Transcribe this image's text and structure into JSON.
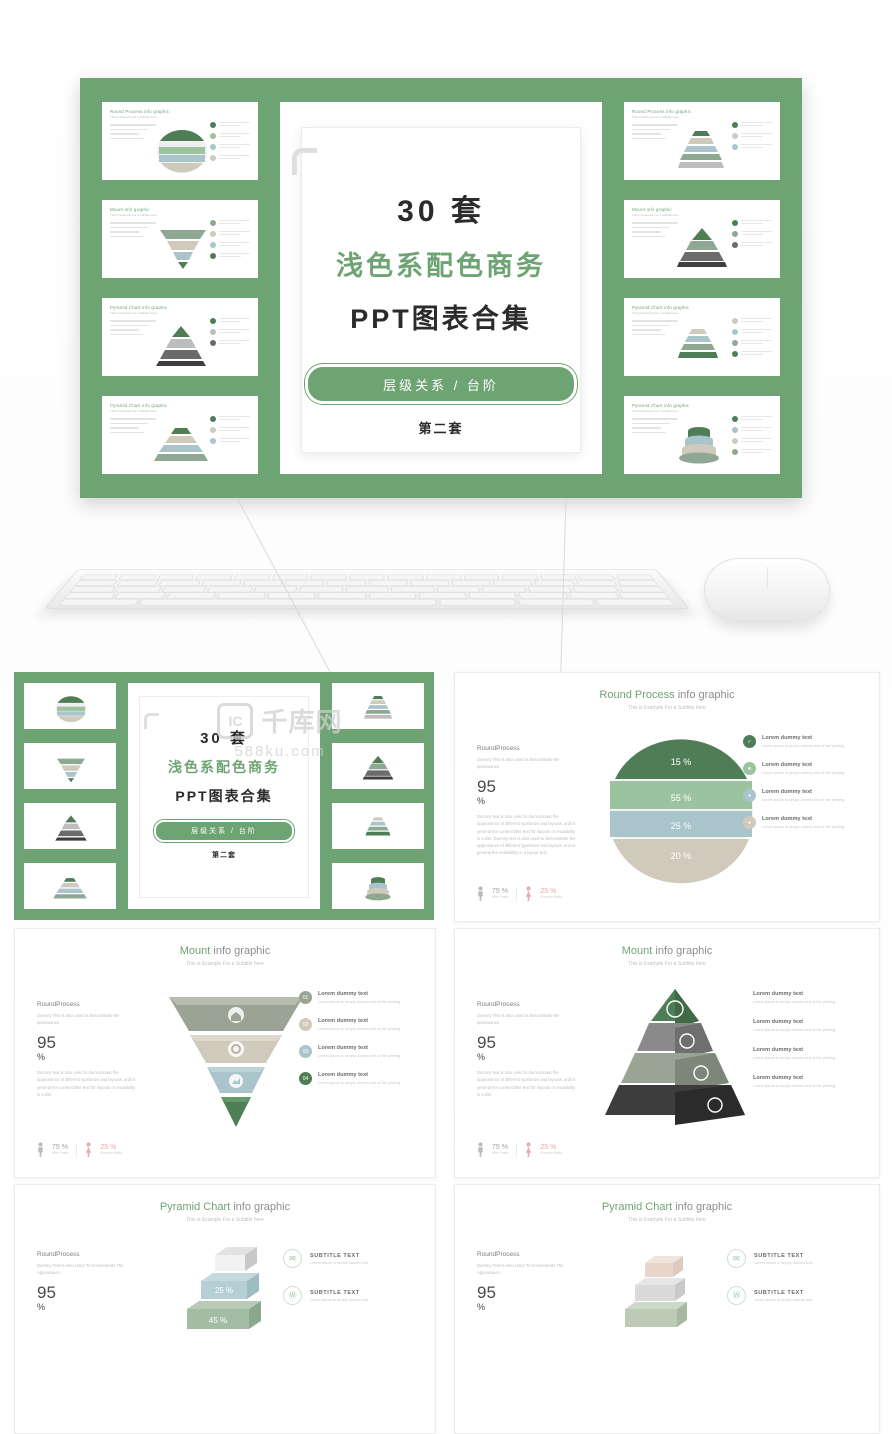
{
  "hero": {
    "line1": "30 套",
    "line2": "浅色系配色商务",
    "line3": "PPT图表合集",
    "pill": "层级关系 / 台阶",
    "subtitle": "第二套",
    "thumb_titles": [
      "Round Process info graphic",
      "Mount info graphic",
      "Pyramid Chart info graphic",
      "Pyramid Chart info graphic",
      "Round Process info graphic",
      "Mount info graphic",
      "Pyramid Chart info graphic",
      "Pyramid Chart info graphic"
    ],
    "thumb_subtitle": "This is Example For a Subtitle here"
  },
  "watermark": {
    "line1": "千库网",
    "line2": "588ku.com",
    "logo": "IC"
  },
  "slides": [
    {
      "id": "cover-thumb",
      "line1": "30 套",
      "line2": "浅色系配色商务",
      "line3": "PPT图表合集",
      "pill": "层级关系 / 台阶",
      "subtitle": "第二套"
    },
    {
      "id": "round-process",
      "title_accent": "Round Process",
      "title_rest": " info graphic",
      "subtitle": "This is Example For a Subtitle here",
      "left_label": "RoundProcess",
      "left_desc": "Dummy Text is also used to demonstrate the appearance",
      "big_number": "95",
      "unit": "%",
      "paragraph": "Dummy text is also used to demonstrate the appearance of different typefaces and layouts, and in general the content filler text for layouts or readability in a site.  Dummy text is also used to demonstrate the appearance of different typefaces and layouts, and in general the readability in a layout text.",
      "footer": [
        {
          "value": "75 %",
          "caption": "Man Ratio"
        },
        {
          "value": "25 %",
          "caption": "Women Ratio"
        }
      ],
      "chart_labels": [
        "15 %",
        "55 %",
        "25 %",
        "20 %"
      ],
      "legend": [
        {
          "title": "Lorem dummy text",
          "desc": "Lorem ipsum is simply dummy text of the printing."
        },
        {
          "title": "Lorem dummy text",
          "desc": "Lorem ipsum is simply dummy text of the printing."
        },
        {
          "title": "Lorem dummy text",
          "desc": "Lorem ipsum is simply dummy text of the printing."
        },
        {
          "title": "Lorem dummy text",
          "desc": "Lorem ipsum is simply dummy text of the printing."
        }
      ]
    },
    {
      "id": "mount-funnel",
      "title_accent": "Mount",
      "title_rest": " info graphic",
      "subtitle": "This is Example For a Subtitle here",
      "left_label": "RoundProcess",
      "left_desc": "Dummy Text is also used to demonstrate the appearance",
      "big_number": "95",
      "unit": "%",
      "paragraph": "Dummy text is also used to demonstrate the appearance of different typefaces and layouts, and in general the content filler text for layouts or readability in a site.",
      "footer": [
        {
          "value": "75 %",
          "caption": "Man Ratio"
        },
        {
          "value": "25 %",
          "caption": "Women Ratio"
        }
      ],
      "legend": [
        {
          "title": "Lorem dummy text",
          "desc": "Lorem ipsum is simply dummy text of the printing."
        },
        {
          "title": "Lorem dummy text",
          "desc": "Lorem ipsum is simply dummy text of the printing."
        },
        {
          "title": "Lorem dummy text",
          "desc": "Lorem ipsum is simply dummy text of the printing."
        },
        {
          "title": "Lorem dummy text",
          "desc": "Lorem ipsum is simply dummy text of the printing."
        }
      ],
      "icons": [
        "home-icon",
        "gear-icon",
        "chart-icon"
      ]
    },
    {
      "id": "mount-pyramid",
      "title_accent": "Mount",
      "title_rest": " info graphic",
      "subtitle": "This is Example For a Subtitle here",
      "left_label": "RoundProcess",
      "left_desc": "Dummy Text is also used to demonstrate the appearance",
      "big_number": "95",
      "unit": "%",
      "paragraph": "Dummy text is also used to demonstrate the appearance of different typefaces and layouts, and in general the content filler text for layouts or readability in a site.",
      "footer": [
        {
          "value": "75 %",
          "caption": "Man Ratio"
        },
        {
          "value": "25 %",
          "caption": "Women Ratio"
        }
      ],
      "callouts": [
        {
          "title": "Lorem dummy text",
          "desc": "Lorem ipsum is simply dummy text of the printing.",
          "icon": "bulb-icon"
        },
        {
          "title": "Lorem dummy text",
          "desc": "Lorem ipsum is simply dummy text of the printing.",
          "icon": "search-icon"
        },
        {
          "title": "Lorem dummy text",
          "desc": "Lorem ipsum is simply dummy text of the printing.",
          "icon": "key-icon"
        },
        {
          "title": "Lorem dummy text",
          "desc": "Lorem ipsum is simply dummy text of the printing.",
          "icon": "umbrella-icon"
        }
      ]
    },
    {
      "id": "pyramid-chart-1",
      "title_accent": "Pyramid Chart",
      "title_rest": " info graphic",
      "subtitle": "This is Example For a Subtitle here",
      "left_label": "RoundProcess",
      "left_desc": "Dummy Text Is Also Used To Demonstrate The Appearance.",
      "big_number": "95",
      "unit": "%",
      "chart_labels": [
        "25 %",
        "45 %"
      ],
      "legend": [
        {
          "title": "SUBTITLE TEXT",
          "desc": "Lorem ipsum is simply dummy text.",
          "icon": "message-icon"
        },
        {
          "title": "SUBTITLE TEXT",
          "desc": "Lorem ipsum is simply dummy text.",
          "icon": "wordpress-icon"
        }
      ]
    },
    {
      "id": "pyramid-chart-2",
      "title_accent": "Pyramid Chart",
      "title_rest": " info graphic",
      "subtitle": "This is Example For a Subtitle here",
      "left_label": "RoundProcess",
      "left_desc": "Dummy Text Is Also Used To Demonstrate The Appearance.",
      "big_number": "95",
      "unit": "%",
      "legend": [
        {
          "title": "SUBTITLE TEXT",
          "desc": "Lorem ipsum is simply dummy text.",
          "icon": "message-icon"
        },
        {
          "title": "SUBTITLE TEXT",
          "desc": "Lorem ipsum is simply dummy text.",
          "icon": "wordpress-icon"
        }
      ]
    }
  ],
  "colors": {
    "brand_green": "#6ea473",
    "light_green": "#9cc3a0",
    "mint": "#b9d4bc",
    "blue_gray": "#a9c4cb",
    "gray": "#9a9a9a",
    "dark_gray": "#5c5c5c",
    "pink": "#e8a6ad"
  }
}
